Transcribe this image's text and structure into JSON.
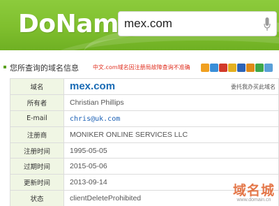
{
  "header": {
    "logo": "DoName",
    "search_value": "mex.com",
    "accent_color": "#7fbf2e"
  },
  "info_bar": {
    "title": "您所查询的域名信息",
    "note": "中文.com域名因注册局故障查询不准确",
    "share_icons": [
      "qzone-icon",
      "sina-weibo-icon",
      "renren-icon",
      "kaixin-icon",
      "facebook-icon",
      "douban-icon",
      "share-icon",
      "plus-icon"
    ]
  },
  "whois": {
    "trust_link": "委托我办买此域名",
    "rows": [
      {
        "label": "域名",
        "value": "mex.com"
      },
      {
        "label": "所有者",
        "value": "Christian Phillips"
      },
      {
        "label": "E-mail",
        "value": "chris@uk.com"
      },
      {
        "label": "注册商",
        "value": "MONIKER ONLINE SERVICES LLC"
      },
      {
        "label": "注册时间",
        "value": "1995-05-05"
      },
      {
        "label": "过期时间",
        "value": "2015-05-06"
      },
      {
        "label": "更新时间",
        "value": "2013-09-14"
      },
      {
        "label": "状态",
        "value": "clientDeleteProhibited"
      }
    ]
  },
  "watermark": {
    "text": "域名城",
    "url": "www.domain.cn"
  }
}
